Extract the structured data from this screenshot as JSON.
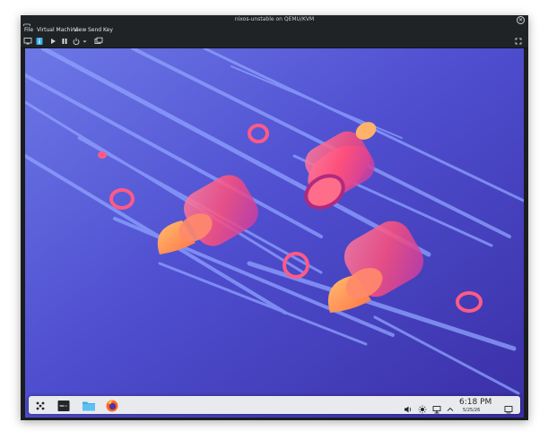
{
  "window": {
    "title": "nixos-unstable on QEMU/KVM",
    "close_glyph": "✕"
  },
  "menu": {
    "items": [
      "File",
      "Virtual Machine",
      "View",
      "Send Key"
    ]
  },
  "toolbar": {
    "icons": [
      "console-icon",
      "details-icon",
      "run-icon",
      "pause-icon",
      "power-icon",
      "dropdown-icon",
      "snapshots-icon",
      "fullscreen-icon"
    ]
  },
  "taskbar": {
    "clock_time": "6:18 PM",
    "clock_date": "5/25/26",
    "launchers": [
      "application-launcher-icon",
      "terminal-icon",
      "file-manager-icon",
      "firefox-icon"
    ],
    "tray": [
      "volume-icon",
      "brightness-icon",
      "network-icon",
      "tray-expand-icon",
      "show-desktop-icon"
    ]
  },
  "colors": {
    "wallpaper_base": "#3c34b0",
    "wallpaper_accent": "#ff5a6e",
    "taskbar": "#e8eaee",
    "window_chrome": "#202326"
  }
}
